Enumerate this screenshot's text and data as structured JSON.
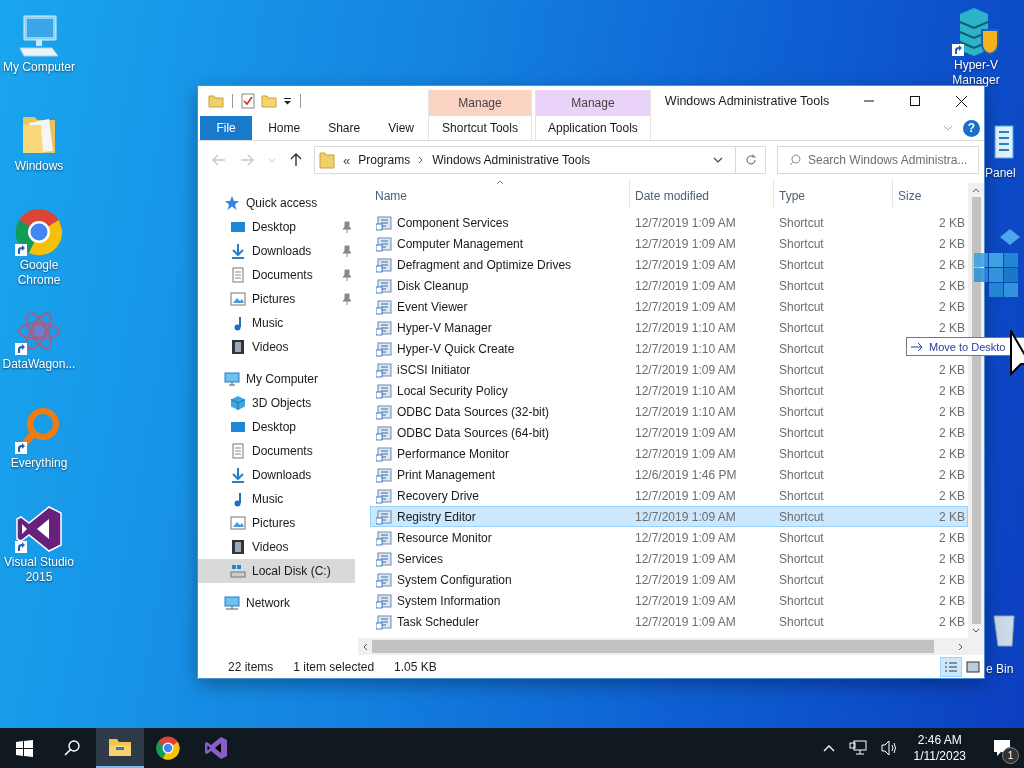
{
  "desktop": {
    "left_icons": [
      {
        "label": "My Computer",
        "kind": "computer",
        "shortcut": false
      },
      {
        "label": "Windows",
        "kind": "folder",
        "shortcut": false
      },
      {
        "label": "Google Chrome",
        "kind": "chrome",
        "shortcut": true
      },
      {
        "label": "DataWagon...",
        "kind": "datawagon",
        "shortcut": true
      },
      {
        "label": "Everything",
        "kind": "everything",
        "shortcut": true
      },
      {
        "label": "Visual Studio 2015",
        "kind": "vs",
        "shortcut": true
      }
    ],
    "right_icons": [
      {
        "label": "Hyper-V Manager",
        "kind": "hyperv",
        "shortcut": true
      },
      {
        "label": "Panel",
        "kind": "panel",
        "shortcut": false
      },
      {
        "label": "e Bin",
        "kind": "bin",
        "shortcut": false
      }
    ]
  },
  "explorer": {
    "title": "Windows Administrative Tools",
    "context_tabs": [
      {
        "group": "Manage",
        "tab": "Shortcut Tools",
        "color": "#fad3c2"
      },
      {
        "group": "Manage",
        "tab": "Application Tools",
        "color": "#ead3f8"
      }
    ],
    "ribbon_tabs": [
      {
        "label": "File",
        "kind": "file"
      },
      {
        "label": "Home",
        "kind": "tab"
      },
      {
        "label": "Share",
        "kind": "tab"
      },
      {
        "label": "View",
        "kind": "tab"
      }
    ],
    "help": "?",
    "address": {
      "overflow": "«",
      "path": [
        "Programs",
        "Windows Administrative Tools"
      ]
    },
    "search": {
      "placeholder": "Search Windows Administra..."
    },
    "nav": [
      {
        "label": "Quick access",
        "kind": "star",
        "selected": false,
        "children": [
          {
            "label": "Desktop",
            "kind": "desktop",
            "pinned": true,
            "selected": false
          },
          {
            "label": "Downloads",
            "kind": "download",
            "pinned": true,
            "selected": false
          },
          {
            "label": "Documents",
            "kind": "documents",
            "pinned": true,
            "selected": false
          },
          {
            "label": "Pictures",
            "kind": "pictures",
            "pinned": true,
            "selected": false
          },
          {
            "label": "Music",
            "kind": "music",
            "pinned": false,
            "selected": false
          },
          {
            "label": "Videos",
            "kind": "videos",
            "pinned": false,
            "selected": false
          }
        ]
      },
      {
        "label": "My Computer",
        "kind": "computer",
        "selected": false,
        "children": [
          {
            "label": "3D Objects",
            "kind": "cube",
            "pinned": false,
            "selected": false
          },
          {
            "label": "Desktop",
            "kind": "desktop",
            "pinned": false,
            "selected": false
          },
          {
            "label": "Documents",
            "kind": "documents",
            "pinned": false,
            "selected": false
          },
          {
            "label": "Downloads",
            "kind": "download",
            "pinned": false,
            "selected": false
          },
          {
            "label": "Music",
            "kind": "music",
            "pinned": false,
            "selected": false
          },
          {
            "label": "Pictures",
            "kind": "pictures",
            "pinned": false,
            "selected": false
          },
          {
            "label": "Videos",
            "kind": "videos",
            "pinned": false,
            "selected": false
          },
          {
            "label": "Local Disk (C:)",
            "kind": "drive",
            "pinned": false,
            "selected": true
          }
        ]
      },
      {
        "label": "Network",
        "kind": "network",
        "selected": false
      }
    ],
    "columns": [
      {
        "label": "Name",
        "sorted": true
      },
      {
        "label": "Date modified",
        "sorted": false
      },
      {
        "label": "Type",
        "sorted": false
      },
      {
        "label": "Size",
        "sorted": false
      }
    ],
    "rows": [
      {
        "name": "Component Services",
        "date": "12/7/2019 1:09 AM",
        "type": "Shortcut",
        "size": "2 KB",
        "selected": false
      },
      {
        "name": "Computer Management",
        "date": "12/7/2019 1:09 AM",
        "type": "Shortcut",
        "size": "2 KB",
        "selected": false
      },
      {
        "name": "Defragment and Optimize Drives",
        "date": "12/7/2019 1:09 AM",
        "type": "Shortcut",
        "size": "2 KB",
        "selected": false
      },
      {
        "name": "Disk Cleanup",
        "date": "12/7/2019 1:09 AM",
        "type": "Shortcut",
        "size": "2 KB",
        "selected": false
      },
      {
        "name": "Event Viewer",
        "date": "12/7/2019 1:09 AM",
        "type": "Shortcut",
        "size": "2 KB",
        "selected": false
      },
      {
        "name": "Hyper-V Manager",
        "date": "12/7/2019 1:10 AM",
        "type": "Shortcut",
        "size": "2 KB",
        "selected": false
      },
      {
        "name": "Hyper-V Quick Create",
        "date": "12/7/2019 1:10 AM",
        "type": "Shortcut",
        "selected": false
      },
      {
        "name": "iSCSI Initiator",
        "date": "12/7/2019 1:09 AM",
        "type": "Shortcut",
        "size": "2 KB",
        "selected": false
      },
      {
        "name": "Local Security Policy",
        "date": "12/7/2019 1:10 AM",
        "type": "Shortcut",
        "size": "2 KB",
        "selected": false
      },
      {
        "name": "ODBC Data Sources (32-bit)",
        "date": "12/7/2019 1:10 AM",
        "type": "Shortcut",
        "size": "2 KB",
        "selected": false
      },
      {
        "name": "ODBC Data Sources (64-bit)",
        "date": "12/7/2019 1:09 AM",
        "type": "Shortcut",
        "size": "2 KB",
        "selected": false
      },
      {
        "name": "Performance Monitor",
        "date": "12/7/2019 1:09 AM",
        "type": "Shortcut",
        "size": "2 KB",
        "selected": false
      },
      {
        "name": "Print Management",
        "date": "12/6/2019 1:46 PM",
        "type": "Shortcut",
        "size": "2 KB",
        "selected": false
      },
      {
        "name": "Recovery Drive",
        "date": "12/7/2019 1:09 AM",
        "type": "Shortcut",
        "size": "2 KB",
        "selected": false
      },
      {
        "name": "Registry Editor",
        "date": "12/7/2019 1:09 AM",
        "type": "Shortcut",
        "size": "2 KB",
        "selected": true
      },
      {
        "name": "Resource Monitor",
        "date": "12/7/2019 1:09 AM",
        "type": "Shortcut",
        "size": "2 KB",
        "selected": false
      },
      {
        "name": "Services",
        "date": "12/7/2019 1:09 AM",
        "type": "Shortcut",
        "size": "2 KB",
        "selected": false
      },
      {
        "name": "System Configuration",
        "date": "12/7/2019 1:09 AM",
        "type": "Shortcut",
        "size": "2 KB",
        "selected": false
      },
      {
        "name": "System Information",
        "date": "12/7/2019 1:09 AM",
        "type": "Shortcut",
        "size": "2 KB",
        "selected": false
      },
      {
        "name": "Task Scheduler",
        "date": "12/7/2019 1:09 AM",
        "type": "Shortcut",
        "size": "2 KB",
        "selected": false
      }
    ],
    "status": {
      "count": "22 items",
      "selection": "1 item selected",
      "size": "1.05 KB"
    },
    "views": [
      {
        "kind": "details",
        "selected": true
      },
      {
        "kind": "large",
        "selected": false
      }
    ]
  },
  "drag": {
    "tooltip": "Move to Deskto"
  },
  "taskbar": {
    "apps": [
      {
        "kind": "explorer",
        "active": true
      },
      {
        "kind": "chrome",
        "active": false
      },
      {
        "kind": "vs",
        "active": false
      }
    ],
    "time": "2:46 AM",
    "date": "1/11/2023",
    "notifications": "1"
  }
}
